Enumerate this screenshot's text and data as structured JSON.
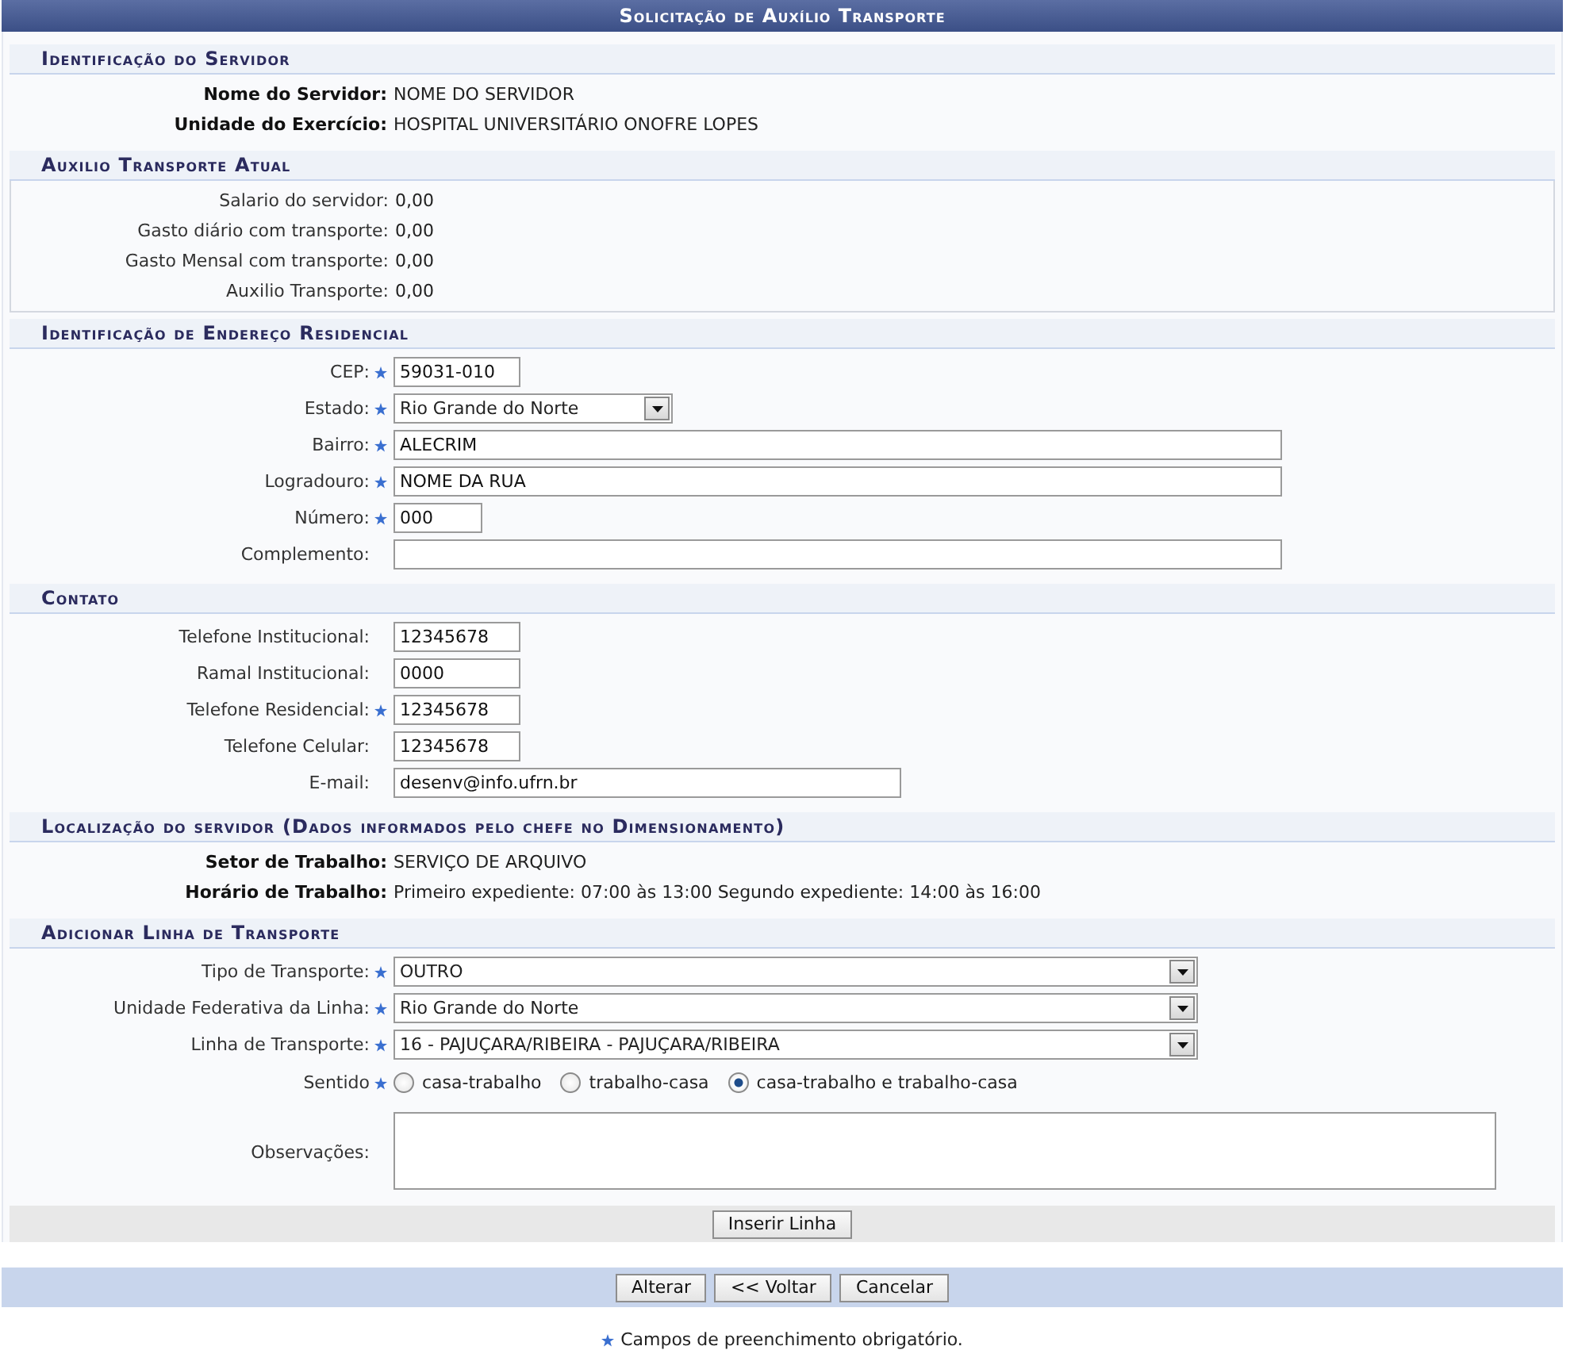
{
  "title": "Solicitação de Auxílio Transporte",
  "sections": [
    {
      "heading": "Identificação do Servidor",
      "kind": "info",
      "rows": [
        {
          "kind": "text",
          "label": "Nome do Servidor:",
          "value": "NOME DO SERVIDOR"
        },
        {
          "kind": "text",
          "label": "Unidade do Exercício:",
          "value": "HOSPITAL UNIVERSITÁRIO ONOFRE LOPES"
        }
      ]
    },
    {
      "heading": "Auxilio Transporte Atual",
      "kind": "summary",
      "rows": [
        {
          "kind": "text",
          "label": "Salario do servidor:",
          "value": "0,00"
        },
        {
          "kind": "text",
          "label": "Gasto diário com transporte:",
          "value": "0,00"
        },
        {
          "kind": "text",
          "label": "Gasto Mensal com transporte:",
          "value": "0,00"
        },
        {
          "kind": "text",
          "label": "Auxilio Transporte:",
          "value": "0,00"
        }
      ]
    },
    {
      "heading": "Identificação de Endereço Residencial",
      "kind": "form",
      "rows": [
        {
          "kind": "input",
          "label": "CEP:",
          "required": true,
          "value": "59031-010"
        },
        {
          "kind": "select",
          "label": "Estado:",
          "required": true,
          "value": "Rio Grande do Norte"
        },
        {
          "kind": "input",
          "label": "Bairro:",
          "required": true,
          "value": "ALECRIM"
        },
        {
          "kind": "input",
          "label": "Logradouro:",
          "required": true,
          "value": "NOME DA RUA"
        },
        {
          "kind": "input",
          "label": "Número:",
          "required": true,
          "value": "000"
        },
        {
          "kind": "input",
          "label": "Complemento:",
          "required": false
        }
      ]
    },
    {
      "heading": "Contato",
      "kind": "form",
      "rows": [
        {
          "kind": "input",
          "label": "Telefone Institucional:",
          "required": false,
          "value": "12345678"
        },
        {
          "kind": "input",
          "label": "Ramal Institucional:",
          "required": false,
          "value": "0000"
        },
        {
          "kind": "input",
          "label": "Telefone Residencial:",
          "required": true,
          "value": "12345678"
        },
        {
          "kind": "input",
          "label": "Telefone Celular:",
          "required": false,
          "value": "12345678"
        },
        {
          "kind": "input",
          "label": "E-mail:",
          "required": false,
          "value": "desenv@info.ufrn.br"
        }
      ]
    },
    {
      "heading": "Localização do servidor (Dados informados pelo chefe no Dimensionamento)",
      "kind": "info",
      "rows": [
        {
          "kind": "text",
          "label": "Setor de Trabalho:",
          "value": "SERVIÇO DE ARQUIVO"
        },
        {
          "kind": "text",
          "label": "Horário de Trabalho:",
          "value": "Primeiro expediente: 07:00 às 13:00 Segundo expediente: 14:00 às 16:00"
        }
      ]
    },
    {
      "heading": "Adicionar Linha de Transporte",
      "kind": "form",
      "rows": [
        {
          "kind": "select",
          "label": "Tipo de Transporte:",
          "required": true,
          "value": "OUTRO"
        },
        {
          "kind": "select",
          "label": "Unidade Federativa da Linha:",
          "required": true,
          "value": "Rio Grande do Norte"
        },
        {
          "kind": "select",
          "label": "Linha de Transporte:",
          "required": true,
          "value": "16 - PAJUÇARA/RIBEIRA - PAJUÇARA/RIBEIRA"
        },
        {
          "kind": "radio",
          "label": "Sentido",
          "required": true,
          "options": [
            {
              "label": "casa-trabalho",
              "selected": false
            },
            {
              "label": "trabalho-casa",
              "selected": false
            },
            {
              "label": "casa-trabalho e trabalho-casa",
              "selected": true
            }
          ]
        },
        {
          "kind": "textarea",
          "label": "Observações:",
          "required": false
        }
      ],
      "action": "Inserir Linha"
    }
  ],
  "buttons": [
    "Alterar",
    "<< Voltar",
    "Cancelar"
  ],
  "note": "Campos de preenchimento obrigatório."
}
